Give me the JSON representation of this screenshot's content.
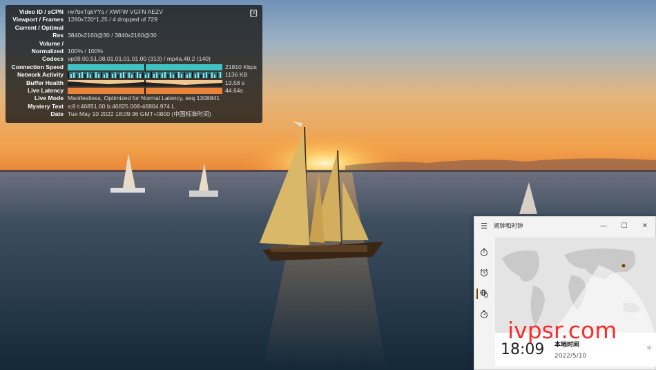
{
  "stats": {
    "close_label": "[X]",
    "rows": [
      {
        "key": "Video ID / sCPN",
        "value": "rw7bxTqkYYs  /  XWFW VGFN AEZV"
      },
      {
        "key": "Viewport / Frames",
        "value": "1280x720*1.25 / 4 dropped of 729"
      },
      {
        "key": "Current / Optimal",
        "value": ""
      },
      {
        "key": "Res",
        "value": "3840x2160@30 / 3840x2160@30"
      },
      {
        "key": "Volume /",
        "value": ""
      },
      {
        "key": "Normalized",
        "value": "100% / 100%"
      },
      {
        "key": "Codecs",
        "value": "vp09.00.51.08.01.01.01.01.00 (313) / mp4a.40.2 (140)"
      },
      {
        "key": "Connection Speed",
        "value": "21810 Kbps"
      },
      {
        "key": "Network Activity",
        "value": "1136 KB"
      },
      {
        "key": "Buffer Health",
        "value": "13.58 s"
      },
      {
        "key": "Live Latency",
        "value": "44.64s"
      },
      {
        "key": "Live Mode",
        "value": "Manifestless, Optimized for Normal Latency, seq 1308841"
      },
      {
        "key": "Mystery Text",
        "value": "s:8 t:46851.60 b:46825.008-46864.974 L"
      },
      {
        "key": "Date",
        "value": "Tue May 10 2022 18:09:36 GMT+0800 (中国标准时间)"
      }
    ]
  },
  "clock_app": {
    "title": "闹钟和时钟",
    "minimize": "—",
    "maximize": "☐",
    "close": "✕",
    "menu_icon": "hamburger-icon",
    "nav": [
      "timer-icon",
      "alarm-icon",
      "world-clock-icon",
      "stopwatch-icon"
    ],
    "local": {
      "time": "18:09",
      "place": "本地时间",
      "date": "2022/5/10"
    }
  },
  "watermark": "ivpsr.com",
  "colors": {
    "accent": "#7b3f00",
    "sky_top": "#7e9ec0",
    "sun": "#ffd066",
    "water": "#223446"
  }
}
